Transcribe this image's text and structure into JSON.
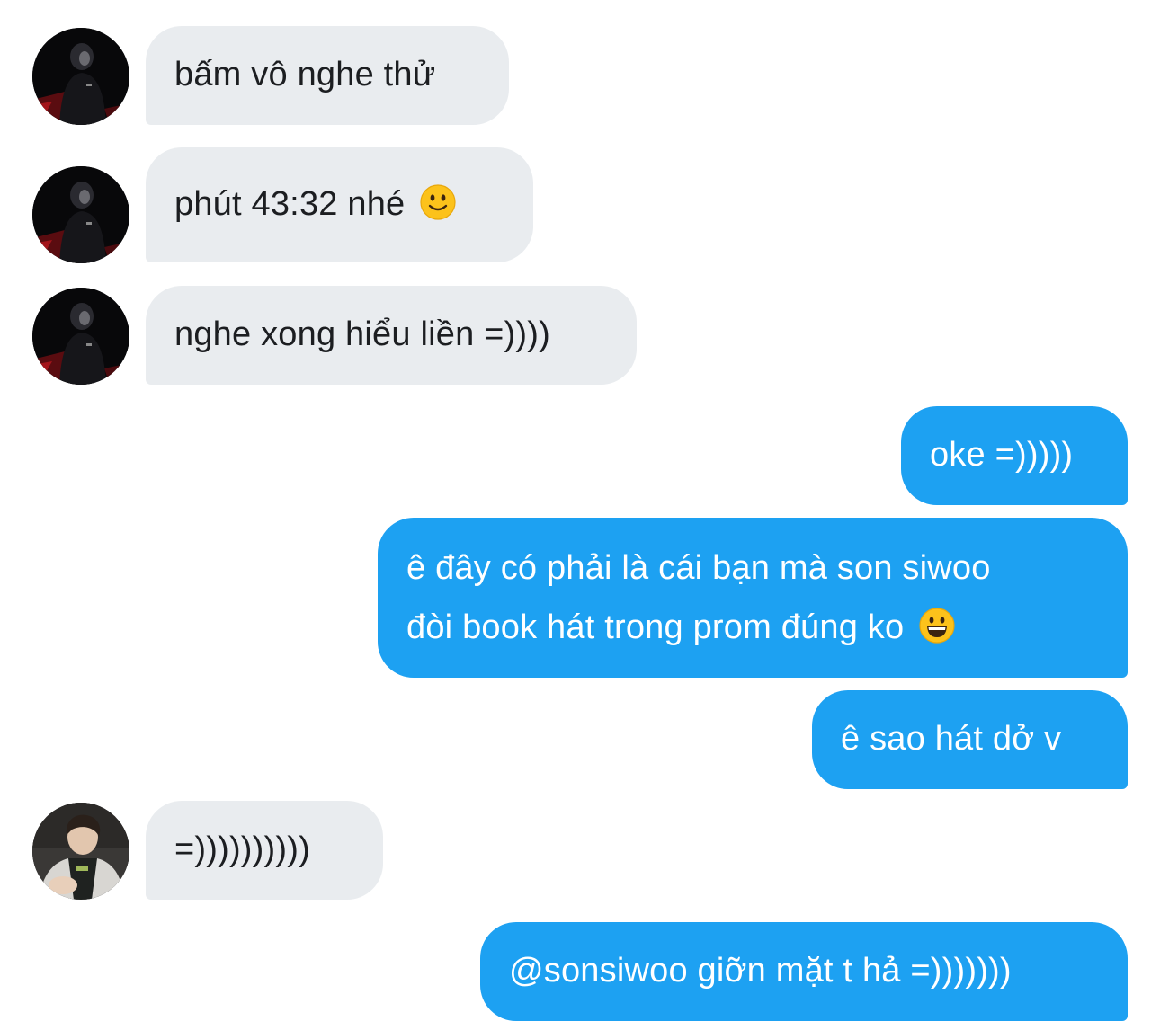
{
  "conversation": {
    "messages": [
      {
        "direction": "incoming",
        "avatar": "dark-portrait-avatar",
        "text": "bấm vô nghe thử"
      },
      {
        "direction": "incoming",
        "avatar": "dark-portrait-avatar",
        "text": "phút 43:32 nhé",
        "emoji": "slightly-smiling-face-icon"
      },
      {
        "direction": "incoming",
        "avatar": "dark-portrait-avatar",
        "text": "nghe xong hiểu liền =))))"
      },
      {
        "direction": "outgoing",
        "text": "oke =)))))"
      },
      {
        "direction": "outgoing",
        "lines": [
          "ê đây có phải là cái bạn mà son siwoo",
          "đòi book hát trong prom đúng ko"
        ],
        "emoji": "grinning-face-icon"
      },
      {
        "direction": "outgoing",
        "text": "ê sao hát dở v"
      },
      {
        "direction": "incoming",
        "avatar": "light-portrait-avatar",
        "text": "=))))))))))"
      },
      {
        "direction": "outgoing",
        "text": "@sonsiwoo giỡn mặt t hả =)))))))"
      }
    ]
  },
  "colors": {
    "incoming_bubble": "#e9ecef",
    "incoming_text": "#1c1e21",
    "outgoing_bubble": "#1da1f2",
    "outgoing_text": "#ffffff",
    "emoji_yellow": "#fcc21b"
  }
}
